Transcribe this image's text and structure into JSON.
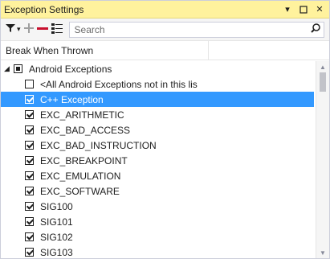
{
  "window": {
    "title": "Exception Settings"
  },
  "toolbar": {
    "search_placeholder": "Search"
  },
  "column": {
    "header": "Break When Thrown"
  },
  "tree": {
    "group_label": "Android Exceptions",
    "items": [
      {
        "label": "<All Android Exceptions not in this lis",
        "checked": false,
        "selected": false
      },
      {
        "label": "C++ Exception",
        "checked": true,
        "selected": true
      },
      {
        "label": "EXC_ARITHMETIC",
        "checked": true,
        "selected": false
      },
      {
        "label": "EXC_BAD_ACCESS",
        "checked": true,
        "selected": false
      },
      {
        "label": "EXC_BAD_INSTRUCTION",
        "checked": true,
        "selected": false
      },
      {
        "label": "EXC_BREAKPOINT",
        "checked": true,
        "selected": false
      },
      {
        "label": "EXC_EMULATION",
        "checked": true,
        "selected": false
      },
      {
        "label": "EXC_SOFTWARE",
        "checked": true,
        "selected": false
      },
      {
        "label": "SIG100",
        "checked": true,
        "selected": false
      },
      {
        "label": "SIG101",
        "checked": true,
        "selected": false
      },
      {
        "label": "SIG102",
        "checked": true,
        "selected": false
      },
      {
        "label": "SIG103",
        "checked": true,
        "selected": false
      }
    ]
  },
  "colors": {
    "title_bg": "#fff29d",
    "selection": "#3399ff",
    "remove_red": "#c8102e",
    "add_gray": "#a0a0a0"
  },
  "icons": [
    "filter-icon",
    "add-icon",
    "remove-icon",
    "restore-list-icon",
    "search-icon",
    "dropdown-icon",
    "maximize-icon",
    "close-icon"
  ]
}
